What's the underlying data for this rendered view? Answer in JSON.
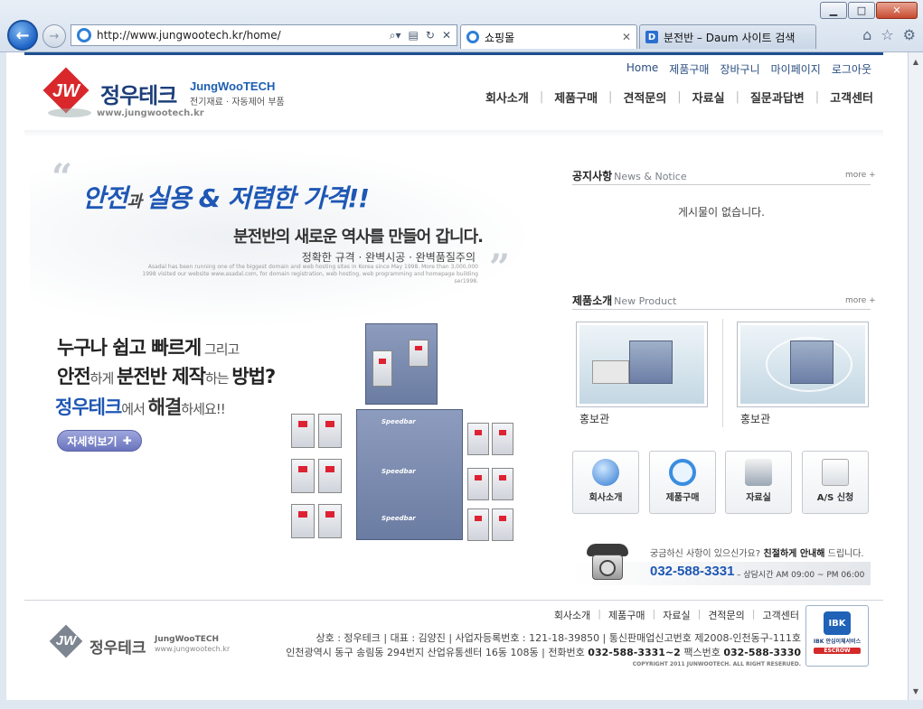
{
  "browser": {
    "url": "http://www.jungwootech.kr/home/",
    "tabs": [
      {
        "label": "쇼핑몰"
      },
      {
        "label": "분전반 – Daum 사이트 검색"
      }
    ]
  },
  "header": {
    "top_links": [
      "Home",
      "제품구매",
      "장바구니",
      "마이페이지",
      "로그아웃"
    ],
    "main_nav": [
      "회사소개",
      "제품구매",
      "견적문의",
      "자료실",
      "질문과답변",
      "고객센터"
    ],
    "brand": {
      "mark": "JW",
      "name": "정우테크",
      "name_en": "JungWooTECH",
      "tagline": "전기재료 · 자동제어 부품",
      "url": "www.jungwootech.kr"
    }
  },
  "hero": {
    "slogan_parts": [
      "안전",
      "과 ",
      "실용 & 저렴한 가격!!"
    ],
    "sub_headline": "분전반의 새로운 역사를 만들어 갑니다.",
    "sub_points": "정확한 규격 · 완벽시공 · 완벽품질주의",
    "english_text": "Asadal has been running one of the biggest domain and web hosting sites in Korea since May 1998. More than 3,000,000 1998 visited our website www.asadal.com, for domain registration, web hosting, web programming and homepage building ser1998.",
    "line1_a": "누구나 쉽고 빠르게",
    "line1_b": " 그리고",
    "line2_a": "안전",
    "line2_b": "하게 ",
    "line2_c": "분전반 제작",
    "line2_d": "하는 ",
    "line2_e": "방법?",
    "line3_a": "정우테크",
    "line3_b": "에서 ",
    "line3_c": "해결",
    "line3_d": "하세요!!",
    "detail_button": "자세히보기",
    "detail_button_icon": "✚",
    "product_brand": "Speedbar"
  },
  "notice": {
    "title": "공지사항",
    "title_en": "News & Notice",
    "more": "more +",
    "empty_message": "게시물이 없습니다."
  },
  "products": {
    "title": "제품소개",
    "title_en": "New Product",
    "more": "more +",
    "items": [
      {
        "caption": "홍보관"
      },
      {
        "caption": "홍보관"
      }
    ]
  },
  "quick_links": [
    {
      "label": "회사소개",
      "icon": "globe-icon"
    },
    {
      "label": "제품구매",
      "icon": "ie-icon"
    },
    {
      "label": "자료실",
      "icon": "folder-icon"
    },
    {
      "label": "A/S 신청",
      "icon": "clipboard-icon"
    }
  ],
  "contact": {
    "question": "궁금하신 사항이 있으신가요?",
    "question_b": " 친절하게 안내해",
    "question_c": " 드립니다.",
    "phone": "032-588-3331",
    "hours": "– 상담시간 AM 09:00 ~ PM 06:00"
  },
  "footer": {
    "nav": [
      "회사소개",
      "제품구매",
      "자료실",
      "견적문의",
      "고객센터"
    ],
    "brand_mark": "JW",
    "brand": "정우테크",
    "brand_en": "JungWooTECH",
    "brand_url": "www.jungwootech.kr",
    "info_line1": "상호 : 정우테크  |  대표 : 김양진  |  사업자등록번호 : 121-18-39850  |  통신판매업신고번호 제2008-인천동구-111호",
    "info_line2_a": "인천광역시 동구 송림동 294번지 산업유통센터 16동 108동  |  전화번호 ",
    "info_phone": "032-588-3331~2",
    "info_fax_label": "  팩스번호 ",
    "info_fax": "032-588-3330",
    "copyright": "COPYRIGHT 2011 JUNWOOTECH. ALL RIGHT RESERUED.",
    "escrow": {
      "logo": "IBK",
      "line1": "IBK 안심이체서비스",
      "line2": "ESCROW"
    }
  },
  "colors": {
    "brand_blue": "#1e57b5",
    "brand_red": "#d8282b",
    "nav_dark": "#1e4f8f"
  }
}
